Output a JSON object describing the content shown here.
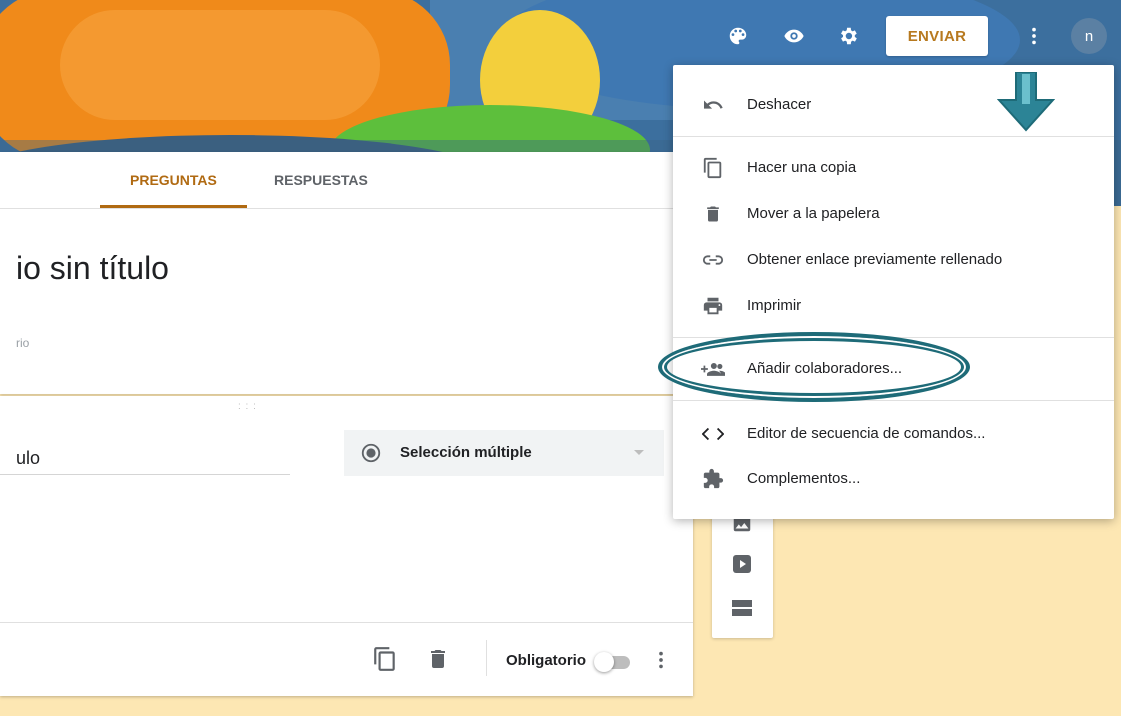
{
  "header": {
    "send_label": "ENVIAR",
    "avatar_initial": "n",
    "icons": [
      "palette-icon",
      "eye-icon",
      "gear-icon",
      "more-vert-icon"
    ]
  },
  "tabs": [
    {
      "label": "PREGUNTAS",
      "active": true
    },
    {
      "label": "RESPUESTAS",
      "active": false
    }
  ],
  "form": {
    "title": "io sin título",
    "description": "rio"
  },
  "question": {
    "title": "ulo",
    "type_label": "Selección múltiple",
    "required_label": "Obligatorio"
  },
  "menu": {
    "items": [
      {
        "label": "Deshacer",
        "icon": "undo-icon"
      },
      {
        "label": "Hacer una copia",
        "icon": "copy-icon"
      },
      {
        "label": "Mover a la papelera",
        "icon": "trash-icon"
      },
      {
        "label": "Obtener enlace previamente rellenado",
        "icon": "link-icon"
      },
      {
        "label": "Imprimir",
        "icon": "print-icon"
      },
      {
        "label": "Añadir colaboradores...",
        "icon": "add-people-icon"
      },
      {
        "label": "Editor de secuencia de comandos...",
        "icon": "code-icon"
      },
      {
        "label": "Complementos...",
        "icon": "puzzle-icon"
      }
    ]
  },
  "colors": {
    "accent": "#b06a12",
    "highlight": "#1e6b78",
    "background": "#fde7b3"
  }
}
